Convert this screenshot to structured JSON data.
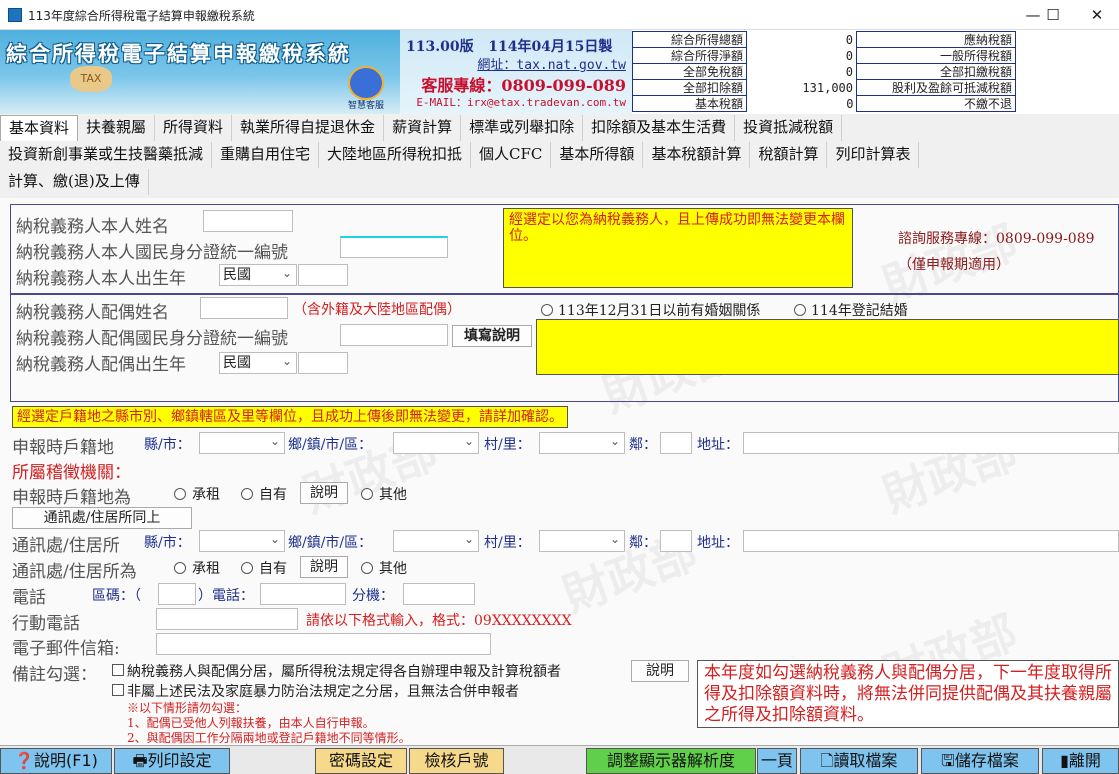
{
  "window": {
    "title": "113年度綜合所得稅電子結算申報繳稅系統",
    "minimize": "—",
    "maximize": "☐",
    "close": "✕"
  },
  "header": {
    "app_title": "綜合所得稅電子結算申報繳稅系統",
    "tax_icon": "TAX",
    "version": "113.00版",
    "date": "114年04月15日製",
    "url_label": "網址：",
    "url": "tax.nat.gov.tw",
    "hotline": "客服專線：0809-099-089",
    "email": "E-MAIL：irx@etax.tradevan.com.tw",
    "assistant": "智慧客服"
  },
  "summary_left": [
    {
      "label": "綜合所得總額",
      "value": "0"
    },
    {
      "label": "綜合所得淨額",
      "value": "0"
    },
    {
      "label": "全部免稅額",
      "value": "0"
    },
    {
      "label": "全部扣除額",
      "value": "131,000"
    },
    {
      "label": "基本稅額",
      "value": "0"
    }
  ],
  "summary_right": [
    {
      "label": "應納稅額"
    },
    {
      "label": "一般所得稅額"
    },
    {
      "label": "全部扣繳稅額"
    },
    {
      "label": "股利及盈餘可抵減稅額"
    },
    {
      "label": "不繳不退"
    }
  ],
  "tabs_row1": [
    "基本資料",
    "扶養親屬",
    "所得資料",
    "執業所得自提退休金",
    "薪資計算",
    "標準或列舉扣除",
    "扣除額及基本生活費",
    "投資抵減稅額"
  ],
  "tabs_row2": [
    "投資新創事業或生技醫藥抵減",
    "重購自用住宅",
    "大陸地區所得稅扣抵",
    "個人CFC",
    "基本所得額",
    "基本稅額計算",
    "稅額計算",
    "列印計算表"
  ],
  "tabs_row3": [
    "計算、繳(退)及上傳"
  ],
  "taxpayer": {
    "name_label": "納稅義務人本人姓名",
    "id_label": "納稅義務人本人國民身分證統一編號",
    "birth_label": "納稅義務人本人出生年",
    "era": "民國",
    "notice": "經選定以您為納稅義務人，且上傳成功即無法變更本欄位。"
  },
  "consult": {
    "hotline": "諮詢服務專線：0809-099-089",
    "note": "（僅申報期適用）"
  },
  "spouse": {
    "name_label": "納稅義務人配偶姓名",
    "name_note": "（含外籍及大陸地區配偶）",
    "id_label": "納稅義務人配偶國民身分證統一編號",
    "help_button": "填寫說明",
    "birth_label": "納稅義務人配偶出生年",
    "era": "民國",
    "marriage_option_1": "113年12月31日以前有婚姻關係",
    "marriage_option_2": "114年登記結婚"
  },
  "address": {
    "warning": "經選定戶籍地之縣市別、鄉鎮轄區及里等欄位，且成功上傳後即無法變更，請詳加確認。",
    "household_label": "申報時戶籍地",
    "county": "縣/市：",
    "township": "鄉/鎮/市/區：",
    "village": "村/里：",
    "neighborhood": "鄰：",
    "addr": "地址：",
    "tax_office_label": "所屬稽徵機關：",
    "household_type_label": "申報時戶籍地為",
    "rent": "承租",
    "own": "自有",
    "explain": "說明",
    "other": "其他",
    "same_button": "通訊處/住居所同上",
    "mailing_label": "通訊處/住居所",
    "mailing_type_label": "通訊處/住居所為"
  },
  "contact": {
    "phone_label": "電話",
    "area_code": "區碼：（",
    "phone": "）電話：",
    "ext": "分機：",
    "mobile_label": "行動電話",
    "mobile_hint": "請依以下格式輸入，格式：09XXXXXXXX",
    "email_label": "電子郵件信箱:"
  },
  "remarks": {
    "label": "備註勾選：",
    "check1": "納稅義務人與配偶分居，屬所得稅法規定得各自辦理申報及計算稅額者",
    "explain": "說明",
    "check2": "非屬上述民法及家庭暴力防治法規定之分居，且無法合併申報者",
    "note_title": "※以下情形請勿勾選：",
    "note1": "1、配偶已受他人列報扶養，由本人自行申報。",
    "note2": "2、與配偶因工作分隔兩地或登記戶籍地不同等情形。",
    "warning": "本年度如勾選納稅義務人與配偶分居，下一年度取得所得及扣除額資料時，將無法併同提供配偶及其扶養親屬之所得及扣除額資料。"
  },
  "watermark": "財政部",
  "bottom": {
    "help": "說明(F1)",
    "print_settings": "列印設定",
    "password": "密碼設定",
    "check_household": "檢核戶號",
    "resolution": "調整顯示器解析度",
    "one_page": "一頁",
    "read_file": "讀取檔案",
    "save_file": "儲存檔案",
    "exit": "離開"
  },
  "colors": {
    "accent": "#1f2f8c",
    "warn": "#d42020",
    "highlight": "#ffff00",
    "banner": "#4fb0de"
  }
}
